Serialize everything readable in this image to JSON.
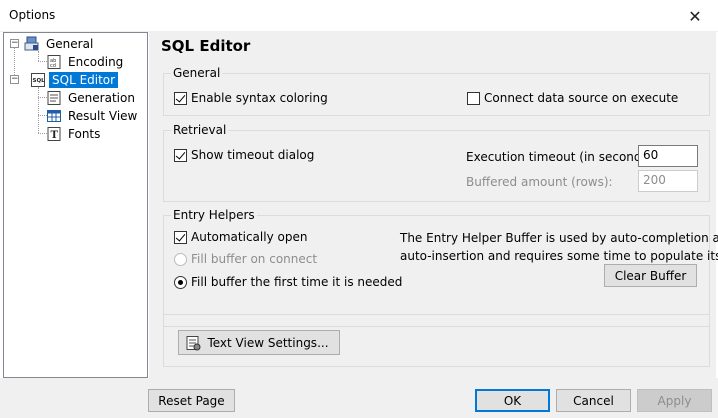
{
  "window": {
    "title": "Options"
  },
  "tree": {
    "items": [
      {
        "label": "General"
      },
      {
        "label": "Encoding"
      },
      {
        "label": "SQL Editor"
      },
      {
        "label": "Generation"
      },
      {
        "label": "Result View"
      },
      {
        "label": "Fonts"
      }
    ]
  },
  "panel": {
    "title": "SQL Editor",
    "general": {
      "legend": "General",
      "enable_syntax": "Enable syntax coloring",
      "connect_on_execute": "Connect data source on execute"
    },
    "retrieval": {
      "legend": "Retrieval",
      "show_timeout": "Show timeout dialog",
      "execution_timeout_label": "Execution timeout (in seconds):",
      "execution_timeout_value": "60",
      "buffered_label": "Buffered amount (rows):",
      "buffered_value": "200"
    },
    "entry_helpers": {
      "legend": "Entry Helpers",
      "auto_open": "Automatically open",
      "fill_on_connect": "Fill buffer on connect",
      "fill_first_time": "Fill buffer the first time it is needed",
      "description_line1": "The Entry Helper Buffer is used by auto-completion and",
      "description_line2": "auto-insertion and requires some time to populate itself.",
      "clear_buffer": "Clear Buffer"
    },
    "text_view_settings": "Text View Settings..."
  },
  "footer": {
    "reset_page": "Reset Page",
    "ok": "OK",
    "cancel": "Cancel",
    "apply": "Apply"
  }
}
